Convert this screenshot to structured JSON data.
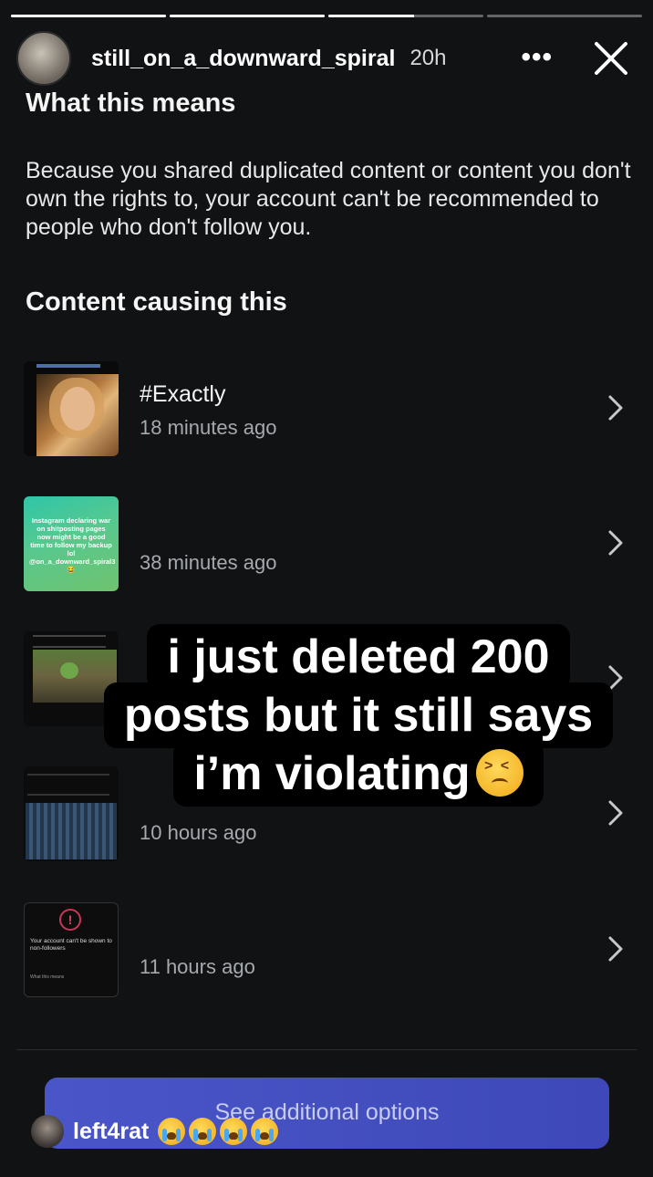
{
  "story": {
    "progress": [
      1,
      1,
      0.55,
      0
    ],
    "username": "still_on_a_downward_spiral",
    "time": "20h"
  },
  "headings": {
    "what_this_means": "What this means",
    "content_causing": "Content causing this"
  },
  "explanation": "Because you shared duplicated content or content you don't own the rights to, your account can't be recommended to people who don't follow you.",
  "items": [
    {
      "title": "#Exactly",
      "time": "18 minutes ago"
    },
    {
      "title": "",
      "time": "38 minutes ago",
      "thumb_text": "Instagram declaring war on shitposting pages now might be a good time to follow my backup lol @on_a_downward_spiral3 😂"
    },
    {
      "title": "",
      "time": ""
    },
    {
      "title": "",
      "time": "10 hours ago"
    },
    {
      "title": "",
      "time": "11 hours ago",
      "thumb_text": "Your account can't be shown to non-followers",
      "thumb_sub": "What this means"
    }
  ],
  "options_button": "See additional options",
  "overlay_caption": {
    "line1": "i just deleted 200",
    "line2": "posts but it still says",
    "line3": "i’m violating"
  },
  "comment": {
    "user": "left4rat",
    "emoji_count": 4
  },
  "icons": {
    "more": "more-icon",
    "close": "close-icon",
    "chevron": "chevron-right-icon"
  },
  "colors": {
    "background": "#101214",
    "button": "#4450c0",
    "muted_text": "#a6a9ad"
  }
}
